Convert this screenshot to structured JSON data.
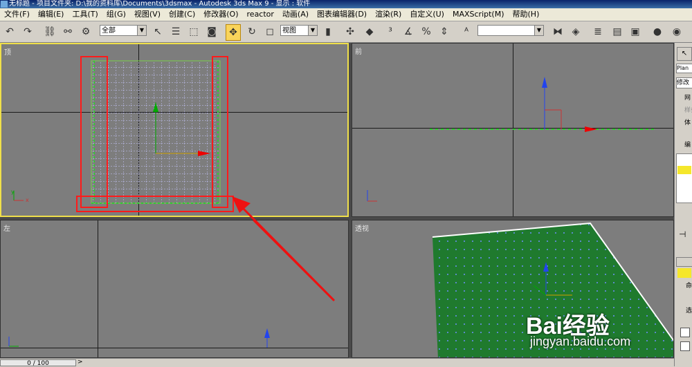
{
  "titlebar": {
    "text": "无标题     - 项目文件夹: D:\\我的资料库\\Documents\\3dsmax     - Autodesk 3ds Max 9      - 显示 : 软件"
  },
  "menu": [
    "文件(F)",
    "编辑(E)",
    "工具(T)",
    "组(G)",
    "视图(V)",
    "创建(C)",
    "修改器(O)",
    "reactor",
    "动画(A)",
    "图表编辑器(D)",
    "渲染(R)",
    "自定义(U)",
    "MAXScript(M)",
    "帮助(H)"
  ],
  "toolbar": {
    "selection_filter": "全部",
    "ref_coord": "视图",
    "named_sel": ""
  },
  "viewports": {
    "top": "顶",
    "front": "前",
    "left": "左",
    "persp": "透视"
  },
  "cmdpanel": {
    "obj_name": "Plan",
    "modify": "修改",
    "btn1": "网",
    "btn2": "样条",
    "btn3": "体",
    "btn4": "编",
    "cmd": "命",
    "sel": "选"
  },
  "status": {
    "frame": "0 / 100"
  },
  "watermark": {
    "brand": "Bai经验",
    "url": "jingyan.baidu.com"
  }
}
